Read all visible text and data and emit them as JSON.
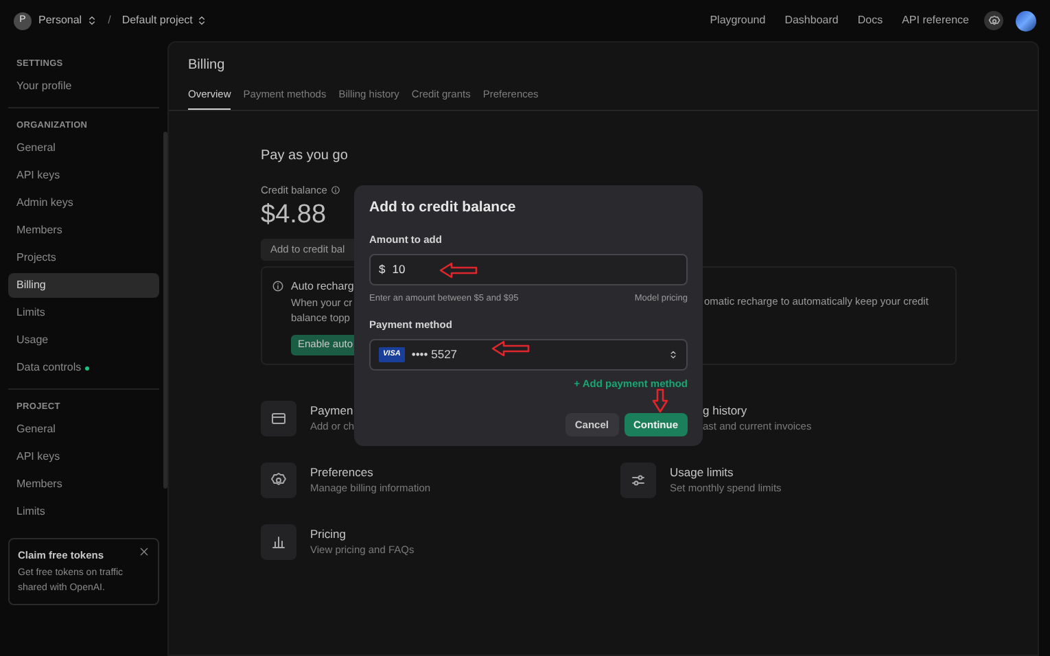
{
  "topbar": {
    "avatar_letter": "P",
    "workspace": "Personal",
    "separator": "/",
    "project": "Default project",
    "links": [
      "Playground",
      "Dashboard",
      "Docs",
      "API reference"
    ]
  },
  "sidebar": {
    "sections": [
      {
        "heading": "SETTINGS",
        "items": [
          {
            "label": "Your profile",
            "selected": false,
            "dot": false
          }
        ]
      },
      {
        "heading": "ORGANIZATION",
        "items": [
          {
            "label": "General",
            "selected": false,
            "dot": false
          },
          {
            "label": "API keys",
            "selected": false,
            "dot": false
          },
          {
            "label": "Admin keys",
            "selected": false,
            "dot": false
          },
          {
            "label": "Members",
            "selected": false,
            "dot": false
          },
          {
            "label": "Projects",
            "selected": false,
            "dot": false
          },
          {
            "label": "Billing",
            "selected": true,
            "dot": false
          },
          {
            "label": "Limits",
            "selected": false,
            "dot": false
          },
          {
            "label": "Usage",
            "selected": false,
            "dot": false
          },
          {
            "label": "Data controls",
            "selected": false,
            "dot": true
          }
        ]
      },
      {
        "heading": "PROJECT",
        "items": [
          {
            "label": "General",
            "selected": false,
            "dot": false
          },
          {
            "label": "API keys",
            "selected": false,
            "dot": false
          },
          {
            "label": "Members",
            "selected": false,
            "dot": false
          },
          {
            "label": "Limits",
            "selected": false,
            "dot": false
          }
        ]
      }
    ],
    "promo": {
      "title": "Claim free tokens",
      "text": "Get free tokens on traffic shared with OpenAI."
    }
  },
  "page": {
    "title": "Billing",
    "tabs": [
      {
        "label": "Overview",
        "selected": true
      },
      {
        "label": "Payment methods",
        "selected": false
      },
      {
        "label": "Billing history",
        "selected": false
      },
      {
        "label": "Credit grants",
        "selected": false
      },
      {
        "label": "Preferences",
        "selected": false
      }
    ],
    "heading": "Pay as you go",
    "balance_label": "Credit balance",
    "balance": "$4.88",
    "add_button": "Add to credit bal",
    "auto_recharge": {
      "title": "Auto recharg",
      "lines": [
        "When your cr",
        "balance topp"
      ],
      "button": "Enable auto",
      "right_text": "omatic recharge to automatically keep your credit"
    },
    "cards": [
      {
        "kind": "tile",
        "title": "Paymen",
        "description": "Add or ch"
      },
      {
        "kind": "clipped",
        "title": "g history",
        "description": "ast and current invoices"
      },
      {
        "kind": "tile",
        "title": "Preferences",
        "description": "Manage billing information"
      },
      {
        "kind": "tile",
        "title": "Usage limits",
        "description": "Set monthly spend limits"
      },
      {
        "kind": "tile",
        "title": "Pricing",
        "description": "View pricing and FAQs"
      }
    ]
  },
  "dialog": {
    "title": "Add to credit balance",
    "amount_label": "Amount to add",
    "currency": "$",
    "amount": "10",
    "hint": "Enter an amount between $5 and $95",
    "pricing_link": "Model pricing",
    "method_label": "Payment method",
    "card_brand": "VISA",
    "card_number": "•••• 5527",
    "add_method": "+ Add payment method",
    "buttons": [
      {
        "label": "Cancel",
        "primary": false
      },
      {
        "label": "Continue",
        "primary": true
      }
    ]
  }
}
